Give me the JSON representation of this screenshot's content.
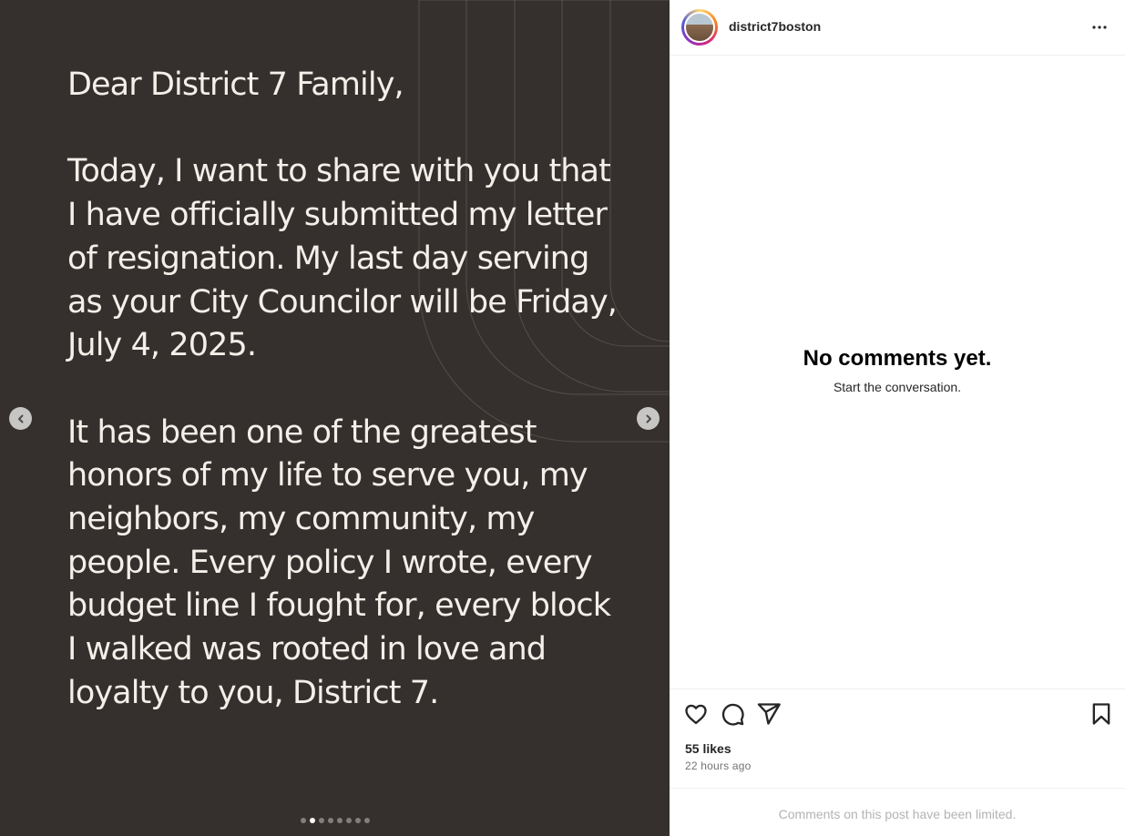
{
  "post": {
    "slides_total": 8,
    "active_slide": 2,
    "letter": {
      "greeting": "Dear District 7 Family,",
      "paragraph_1": "Today, I want to share with you that I have officially submitted my letter of resignation. My last day serving as your City Councilor will be Friday, July 4, 2025.",
      "paragraph_2": "It has been one of the greatest honors of my life to serve you, my neighbors, my community, my people. Every policy I wrote, every budget line I fought for, every block I walked was rooted in love and loyalty to you, District 7."
    },
    "icons": {
      "prev": "chevron-left-icon",
      "next": "chevron-right-icon"
    }
  },
  "header": {
    "username": "district7boston",
    "more_icon": "more-horizontal-icon"
  },
  "comments": {
    "empty_title": "No comments yet.",
    "empty_subtitle": "Start the conversation.",
    "limited_notice": "Comments on this post have been limited."
  },
  "actions": {
    "icons": [
      "heart-icon",
      "comment-icon",
      "share-icon",
      "bookmark-icon"
    ],
    "likes": "55 likes",
    "time": "22 hours ago"
  },
  "colors": {
    "media_background": "#35302d",
    "letter_text": "#f3efe9",
    "muted_text": "#737373"
  }
}
